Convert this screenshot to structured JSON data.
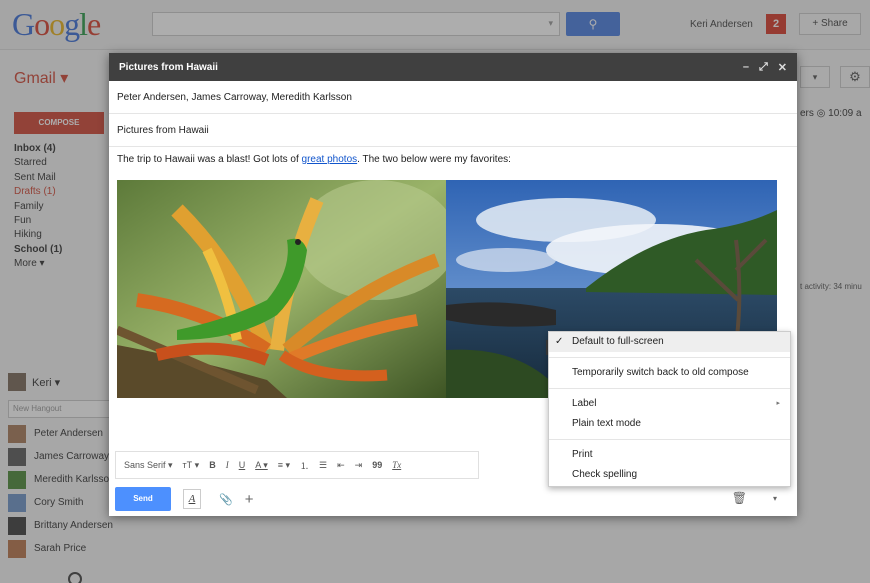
{
  "topbar": {
    "logo_parts": [
      "G",
      "o",
      "o",
      "g",
      "l",
      "e"
    ],
    "search_placeholder": "",
    "user_name": "Keri Andersen",
    "notification_count": "2",
    "share_label": "+ Share"
  },
  "sidebar": {
    "gmail_label": "Gmail ▾",
    "compose_label": "COMPOSE",
    "folders": [
      {
        "label": "Inbox (4)",
        "style": "bold"
      },
      {
        "label": "Starred",
        "style": ""
      },
      {
        "label": "Sent Mail",
        "style": ""
      },
      {
        "label": "Drafts (1)",
        "style": "red"
      },
      {
        "label": "Family",
        "style": ""
      },
      {
        "label": "Fun",
        "style": ""
      },
      {
        "label": "Hiking",
        "style": ""
      },
      {
        "label": "School (1)",
        "style": "bold"
      },
      {
        "label": "More ▾",
        "style": ""
      }
    ],
    "chat_me": "Keri ▾",
    "hangout_placeholder": "New Hangout",
    "contacts": [
      {
        "name": "Peter Andersen",
        "color": "#a87b5a"
      },
      {
        "name": "James Carroway",
        "color": "#5c5c5c"
      },
      {
        "name": "Meredith Karlsson",
        "color": "#4f8a3a"
      },
      {
        "name": "Cory Smith",
        "color": "#6f95c9"
      },
      {
        "name": "Brittany Andersen",
        "color": "#3f3f3f"
      },
      {
        "name": "Sarah Price",
        "color": "#b8764d"
      }
    ]
  },
  "right": {
    "toolbar_label": "▾",
    "time_text": "ers ◎ 10:09 a",
    "activity_text": "t activity: 34 minu"
  },
  "compose": {
    "title": "Pictures from Hawaii",
    "header_icons": [
      "–",
      "⤢",
      "✕"
    ],
    "to": "Peter Andersen, James Carroway, Meredith Karlsson",
    "subject": "Pictures from Hawaii",
    "body_before": "The trip to Hawaii was a blast!  Got lots of ",
    "body_link": "great photos",
    "body_after": ".  The two below were my favorites:",
    "format_bar": {
      "font": "Sans Serif ▾",
      "size": "тТ ▾",
      "bold": "B",
      "italic": "I",
      "underline": "U",
      "text_color": "A ▾",
      "align": "≡ ▾",
      "numbered": "⒈",
      "bullets": "☰",
      "indent_less": "⇤",
      "indent_more": "⇥",
      "quote": "99",
      "clear": "Tx"
    },
    "send_label": "Send",
    "format_toggle": "A",
    "attach_icon": "📎",
    "plus_icon": "+",
    "trash_icon": "🗑",
    "more_icon": "▾"
  },
  "menu": {
    "items_group1": [
      {
        "label": "Default to full-screen",
        "checked": true
      }
    ],
    "items_group2": [
      {
        "label": "Temporarily switch back to old compose"
      }
    ],
    "items_group3": [
      {
        "label": "Label",
        "submenu": "▸"
      },
      {
        "label": "Plain text mode"
      }
    ],
    "items_group4": [
      {
        "label": "Print"
      },
      {
        "label": "Check spelling"
      }
    ],
    "check_mark": "✓"
  },
  "colors": {
    "compose_header": "#404040",
    "send_button": "#4d90fe",
    "gmail_red": "#d14836",
    "link": "#1155cc"
  }
}
